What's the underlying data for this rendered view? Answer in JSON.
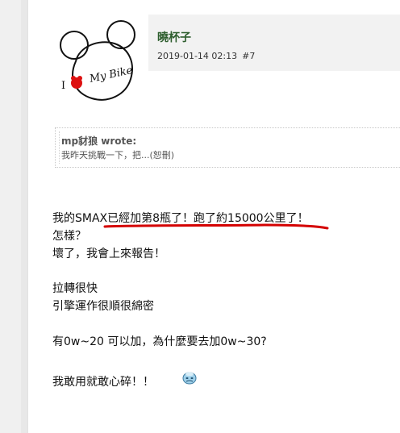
{
  "post": {
    "username": "曉杯子",
    "timestamp": "2019-01-14 02:13",
    "post_number": "#7",
    "avatar": {
      "letter_i": "I",
      "text": "My Bike"
    }
  },
  "quote": {
    "author": "mp豺狼 wrote:",
    "text": "我昨天挑戰一下，把...(恕刪)"
  },
  "body": {
    "lines": [
      "我的SMAX已經加第8瓶了！跑了約15000公里了！",
      "怎樣？",
      "壞了，我會上來報告！",
      "拉轉很快",
      "引擎運作很順很綿密",
      "有0w~20 可以加，為什麼要去加0w~30?",
      "我敢用就敢心碎！！"
    ]
  },
  "colors": {
    "username": "#2e5e2e",
    "underline_mark": "#d40000"
  },
  "icons": {
    "emoticon": "smiley-emoticon-icon"
  }
}
